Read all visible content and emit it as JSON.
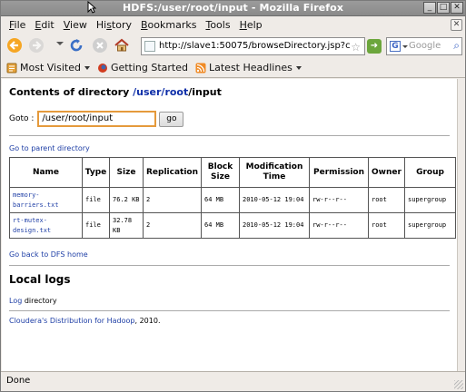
{
  "window": {
    "title": "HDFS:/user/root/input - Mozilla Firefox",
    "controls": [
      "_",
      "□",
      "✕"
    ]
  },
  "menu": {
    "items": [
      {
        "label": "File",
        "key": "F"
      },
      {
        "label": "Edit",
        "key": "E"
      },
      {
        "label": "View",
        "key": "V"
      },
      {
        "label": "History",
        "key": "s"
      },
      {
        "label": "Bookmarks",
        "key": "B"
      },
      {
        "label": "Tools",
        "key": "T"
      },
      {
        "label": "Help",
        "key": "H"
      }
    ]
  },
  "nav": {
    "url": "http://slave1:50075/browseDirectory.jsp?c",
    "search_placeholder": "Google"
  },
  "bookmarks": {
    "items": [
      {
        "label": "Most Visited",
        "icon": "bookmarks-icon",
        "dropdown": true
      },
      {
        "label": "Getting Started",
        "icon": "firefox-icon",
        "dropdown": false
      },
      {
        "label": "Latest Headlines",
        "icon": "rss-icon",
        "dropdown": true
      }
    ]
  },
  "page": {
    "heading_prefix": "Contents of directory",
    "path_sep1": "/",
    "path_user": "user",
    "path_sep2": "/",
    "path_root": "root",
    "path_tail": "/input",
    "goto_label": "Goto :",
    "goto_value": "/user/root/input",
    "go_button": "go",
    "parent_link": "Go to parent directory",
    "table": {
      "headers": [
        "Name",
        "Type",
        "Size",
        "Replication",
        "Block Size",
        "Modification Time",
        "Permission",
        "Owner",
        "Group"
      ],
      "rows": [
        [
          "memory-barriers.txt",
          "file",
          "76.2 KB",
          "2",
          "64 MB",
          "2010-05-12 19:04",
          "rw-r--r--",
          "root",
          "supergroup"
        ],
        [
          "rt-mutex-design.txt",
          "file",
          "32.78 KB",
          "2",
          "64 MB",
          "2010-05-12 19:04",
          "rw-r--r--",
          "root",
          "supergroup"
        ]
      ]
    },
    "dfs_home_link": "Go back to DFS home",
    "local_logs_heading": "Local logs",
    "log_link": "Log",
    "log_suffix": " directory",
    "footer_link": "Cloudera's Distribution for Hadoop",
    "footer_suffix": ", 2010."
  },
  "status": {
    "text": "Done"
  }
}
